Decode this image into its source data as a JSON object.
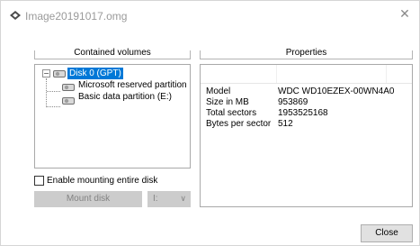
{
  "window": {
    "title": "Image20191017.omg",
    "close_glyph": "✕"
  },
  "left_panel": {
    "header": "Contained volumes",
    "tree": [
      {
        "label": "Disk 0 (GPT)",
        "selected": true,
        "icon": "disk-icon"
      },
      {
        "label": "Microsoft reserved partition",
        "icon": "partition-icon"
      },
      {
        "label": "Basic data partition (E:)",
        "icon": "partition-icon"
      }
    ],
    "expander_glyph": "−"
  },
  "right_panel": {
    "header": "Properties",
    "rows": [
      {
        "key": "Model",
        "value": "WDC WD10EZEX-00WN4A0"
      },
      {
        "key": "Size in MB",
        "value": "953869"
      },
      {
        "key": "Total sectors",
        "value": "1953525168"
      },
      {
        "key": "Bytes per sector",
        "value": "512"
      }
    ]
  },
  "options": {
    "mount_entire_disk_label": "Enable mounting entire disk",
    "mount_entire_disk_checked": false,
    "mount_button_label": "Mount disk",
    "drive_letter_value": "I:",
    "drive_letter_chevron": "∨"
  },
  "footer": {
    "close_button_label": "Close"
  },
  "colors": {
    "selection": "#0078d7",
    "disabled_bg": "#cccccc",
    "disabled_text": "#838383"
  }
}
